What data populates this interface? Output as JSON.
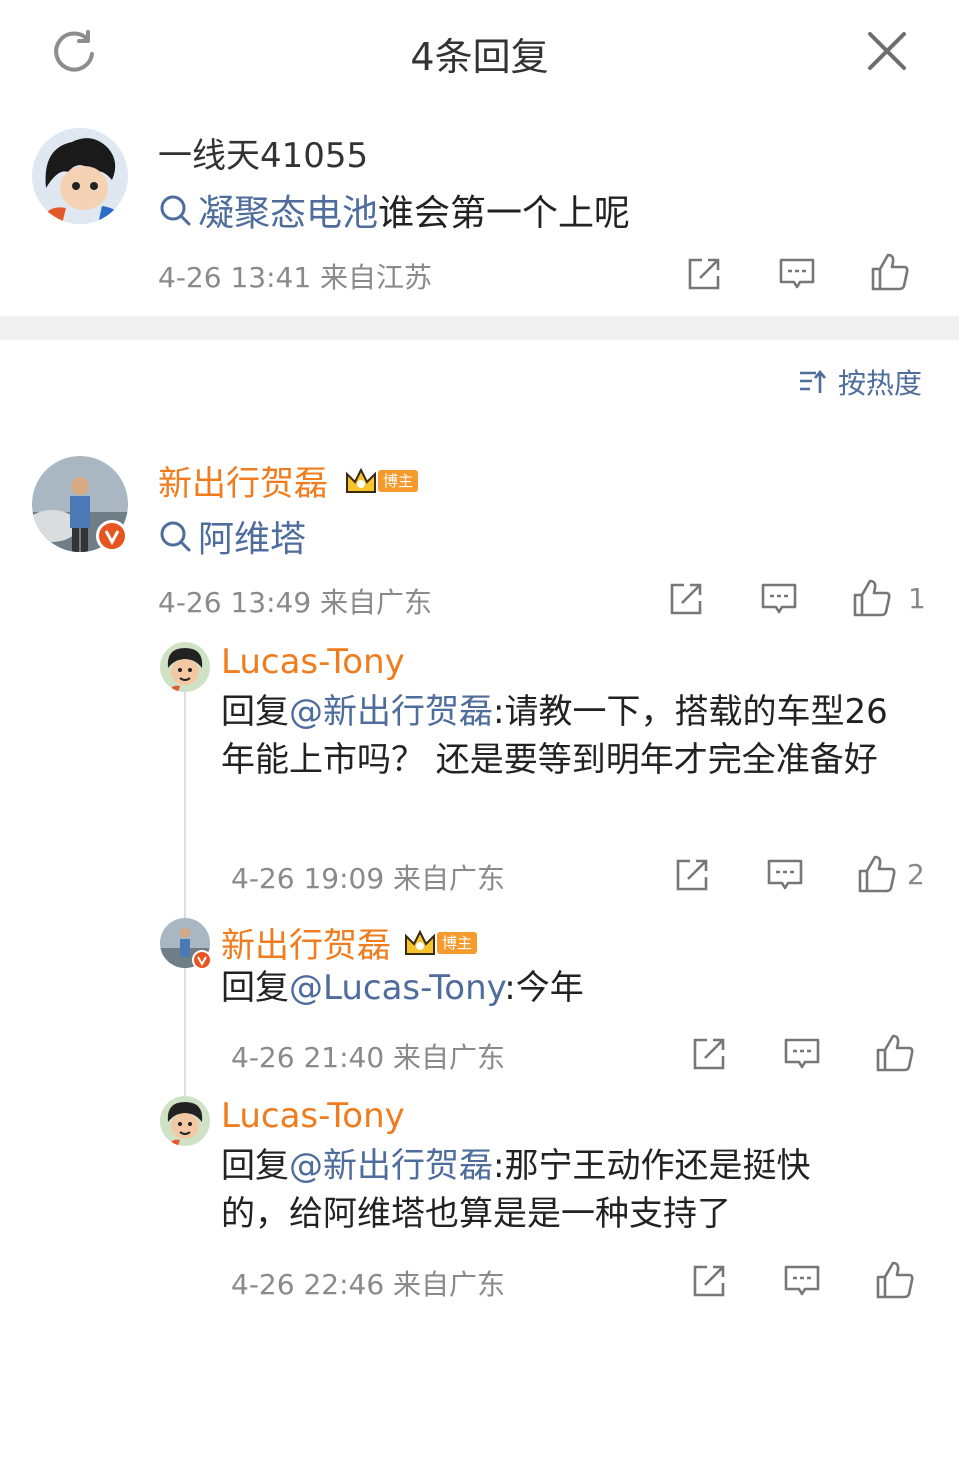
{
  "header": {
    "title": "4条回复"
  },
  "root_comment": {
    "username": "一线天41055",
    "topic_text": "凝聚态电池",
    "body_text": "谁会第一个上呢",
    "timestamp": "4-26 13:41 来自江苏"
  },
  "sort": {
    "label": "按热度"
  },
  "main_comment": {
    "username": "新出行贺磊",
    "badge_label": "博主",
    "topic_text": "阿维塔",
    "timestamp": "4-26 13:49 来自广东",
    "like_count": "1"
  },
  "replies": [
    {
      "username": "Lucas-Tony",
      "reply_prefix": "回复",
      "mention": "@新出行贺磊",
      "body": ":请教一下，搭载的车型26年能上市吗？ 还是要等到明年才完全准备好",
      "timestamp": "4-26 19:09 来自广东",
      "like_count": "2"
    },
    {
      "username": "新出行贺磊",
      "badge_label": "博主",
      "reply_prefix": "回复",
      "mention": "@Lucas-Tony",
      "body": ":今年",
      "timestamp": "4-26 21:40 来自广东",
      "like_count": ""
    },
    {
      "username": "Lucas-Tony",
      "reply_prefix": "回复",
      "mention": "@新出行贺磊",
      "body": ":那宁王动作还是挺快的，给阿维塔也算是是一种支持了",
      "timestamp": "4-26 22:46 来自广东",
      "like_count": ""
    }
  ],
  "colors": {
    "accent_blue": "#4e6c9c",
    "vip_orange": "#f07c1e",
    "badge_orange": "#f59a2c",
    "verified_red": "#e8541f"
  }
}
